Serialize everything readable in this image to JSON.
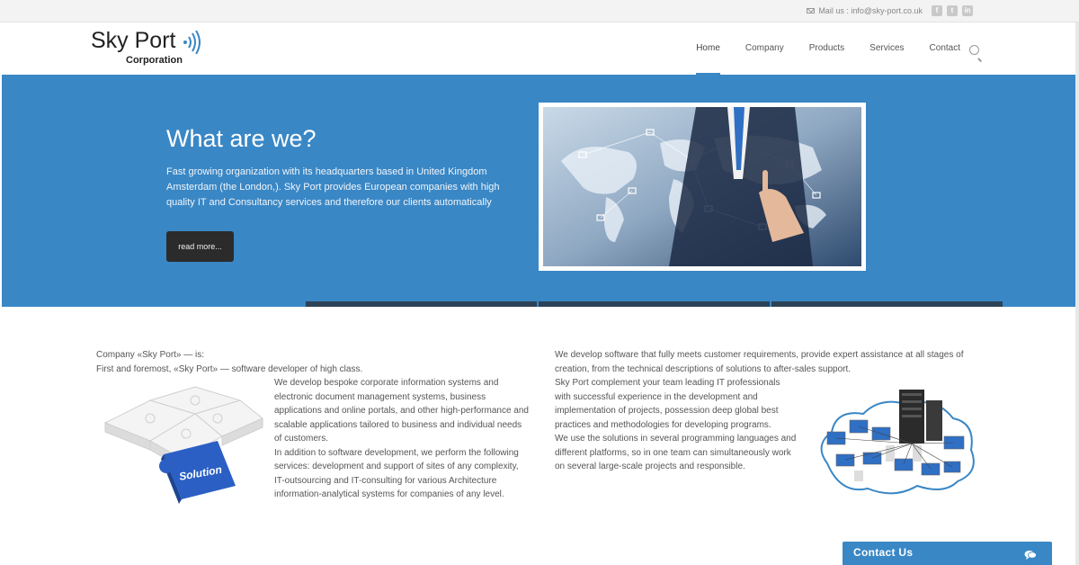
{
  "topbar": {
    "mail_text": "Mail us : info@sky-port.co.uk",
    "social": [
      "f",
      "t",
      "in"
    ]
  },
  "header": {
    "logo_main": "Sky Port",
    "logo_sub": "Corporation",
    "nav": [
      "Home",
      "Company",
      "Products",
      "Services",
      "Contact"
    ],
    "active_nav": "Home"
  },
  "hero": {
    "title": "What are we?",
    "text": "Fast growing organization with its headquarters based in United Kingdom Amsterdam (the London,). Sky Port provides European companies with high quality IT and Consultancy services and therefore our clients automatically",
    "button": "read more..."
  },
  "content": {
    "left_intro_1": "Company «Sky Port» — is:",
    "left_intro_2": "First and foremost, «Sky Port» — software developer of high class.",
    "left_para_1": "We develop bespoke corporate information systems and electronic document management systems, business applications and online portals, and other high-performance and scalable applications tailored to business and individual needs of customers.",
    "left_para_2": "In addition to software development, we perform the following services: development and support of sites of any complexity, IT-outsourcing and IT-consulting for various Architecture information-analytical systems for companies of any level.",
    "puzzle_label": "Solution",
    "right_intro": "We develop software that fully meets customer requirements, provide expert assistance at all stages of creation, from the technical descriptions of solutions to after-sales support.",
    "right_para_1": "Sky Port complement your team leading IT professionals with successful experience in the development and implementation of projects, possession deep global best practices and methodologies for developing programs.",
    "right_para_2": "We use the solutions in several programming languages and different platforms, so in one team can simultaneously work on several large-scale projects and responsible."
  },
  "contact": {
    "label": "Contact Us"
  },
  "colors": {
    "accent": "#3a87c5",
    "dark": "#2b2b2b"
  }
}
